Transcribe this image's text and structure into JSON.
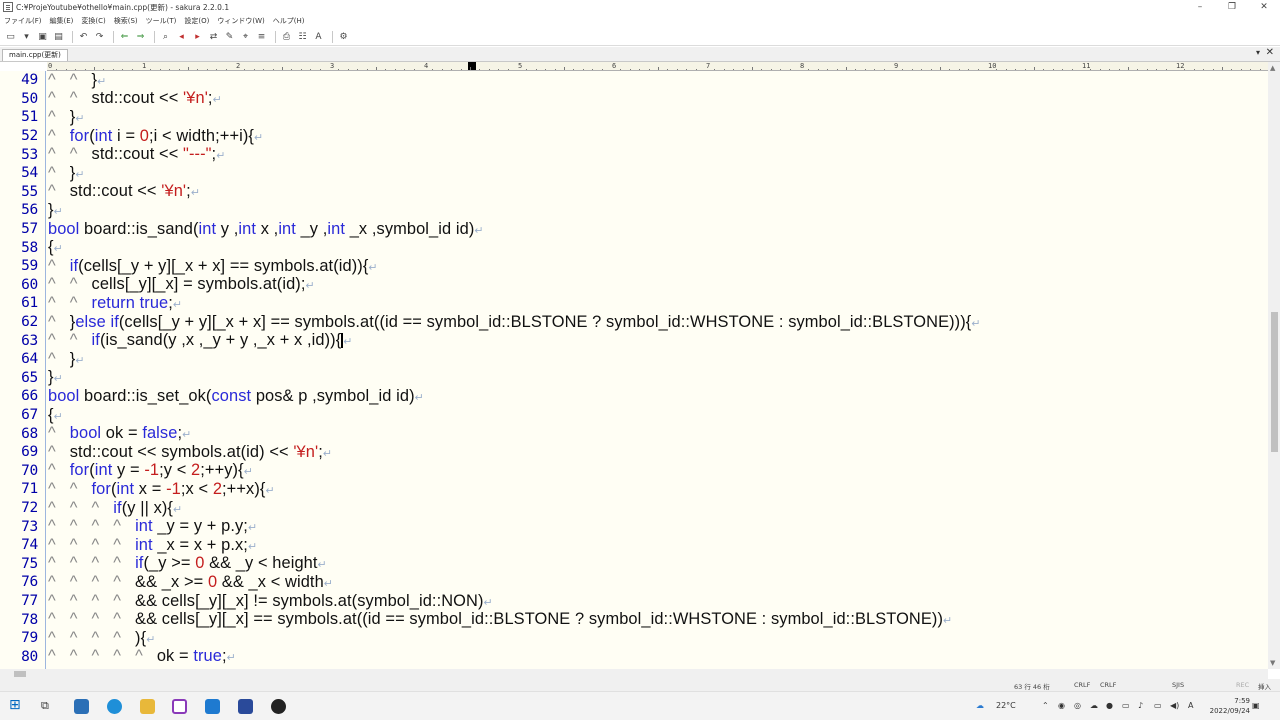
{
  "window": {
    "title": "C:¥ProjeYoutube¥othello¥main.cpp(更新) - sakura 2.2.0.1",
    "controls": {
      "minimize": "–",
      "restore": "❐",
      "close": "✕"
    }
  },
  "menu": [
    "ファイル(F)",
    "編集(E)",
    "変換(C)",
    "検索(S)",
    "ツール(T)",
    "設定(O)",
    "ウィンドウ(W)",
    "ヘルプ(H)"
  ],
  "tab": {
    "label": "main.cpp(更新)",
    "menu_glyph": "▾",
    "close_glyph": "✕"
  },
  "ruler": [
    "0",
    "1",
    "2",
    "3",
    "4",
    "5",
    "6",
    "7",
    "8",
    "9",
    "10",
    "11",
    "12"
  ],
  "lines": [
    {
      "n": "49",
      "html": "<span class=\"tabm\">^</span>   <span class=\"tabm\">^</span>   }<span class=\"crlf\">↵</span>"
    },
    {
      "n": "50",
      "html": "<span class=\"tabm\">^</span>   <span class=\"tabm\">^</span>   std::cout &lt;&lt; <span class=\"str\">'¥n'</span>;<span class=\"crlf\">↵</span>"
    },
    {
      "n": "51",
      "html": "<span class=\"tabm\">^</span>   }<span class=\"crlf\">↵</span>"
    },
    {
      "n": "52",
      "html": "<span class=\"tabm\">^</span>   <span class=\"kw\">for</span>(<span class=\"kw\">int</span> i = <span class=\"num\">0</span>;i &lt; width;++i){<span class=\"crlf\">↵</span>"
    },
    {
      "n": "53",
      "html": "<span class=\"tabm\">^</span>   <span class=\"tabm\">^</span>   std::cout &lt;&lt; <span class=\"str\">\"---\"</span>;<span class=\"crlf\">↵</span>"
    },
    {
      "n": "54",
      "html": "<span class=\"tabm\">^</span>   }<span class=\"crlf\">↵</span>"
    },
    {
      "n": "55",
      "html": "<span class=\"tabm\">^</span>   std::cout &lt;&lt; <span class=\"str\">'¥n'</span>;<span class=\"crlf\">↵</span>"
    },
    {
      "n": "56",
      "html": "}<span class=\"crlf\">↵</span>"
    },
    {
      "n": "57",
      "html": "<span class=\"kw\">bool</span> board::is_sand(<span class=\"kw\">int</span> y ,<span class=\"kw\">int</span> x ,<span class=\"kw\">int</span> _y ,<span class=\"kw\">int</span> _x ,symbol_id id)<span class=\"crlf\">↵</span>"
    },
    {
      "n": "58",
      "html": "{<span class=\"crlf\">↵</span>"
    },
    {
      "n": "59",
      "html": "<span class=\"tabm\">^</span>   <span class=\"kw\">if</span>(cells[_y + y][_x + x] == symbols.at(id)){<span class=\"crlf\">↵</span>"
    },
    {
      "n": "60",
      "html": "<span class=\"tabm\">^</span>   <span class=\"tabm\">^</span>   cells[_y][_x] = symbols.at(id);<span class=\"crlf\">↵</span>"
    },
    {
      "n": "61",
      "html": "<span class=\"tabm\">^</span>   <span class=\"tabm\">^</span>   <span class=\"kw\">return</span> <span class=\"kw\">true</span>;<span class=\"crlf\">↵</span>"
    },
    {
      "n": "62",
      "html": "<span class=\"tabm\">^</span>   }<span class=\"kw\">else</span> <span class=\"kw\">if</span>(cells[_y + y][_x + x] == symbols.at((id == symbol_id::BLSTONE ? symbol_id::WHSTONE : symbol_id::BLSTONE))){<span class=\"crlf\">↵</span>"
    },
    {
      "n": "63",
      "html": "<span class=\"tabm\">^</span>   <span class=\"tabm\">^</span>   <span class=\"kw\">if</span>(is_sand(y ,x ,_y + y ,_x + x ,id)){<span class=\"caret\"></span><span class=\"crlf\">↵</span>"
    },
    {
      "n": "64",
      "html": "<span class=\"tabm\">^</span>   }<span class=\"crlf\">↵</span>"
    },
    {
      "n": "65",
      "html": "}<span class=\"crlf\">↵</span>"
    },
    {
      "n": "66",
      "html": "<span class=\"kw\">bool</span> board::is_set_ok(<span class=\"kw\">const</span> pos&amp; p ,symbol_id id)<span class=\"crlf\">↵</span>"
    },
    {
      "n": "67",
      "html": "{<span class=\"crlf\">↵</span>"
    },
    {
      "n": "68",
      "html": "<span class=\"tabm\">^</span>   <span class=\"kw\">bool</span> ok = <span class=\"kw\">false</span>;<span class=\"crlf\">↵</span>"
    },
    {
      "n": "69",
      "html": "<span class=\"tabm\">^</span>   std::cout &lt;&lt; symbols.at(id) &lt;&lt; <span class=\"str\">'¥n'</span>;<span class=\"crlf\">↵</span>"
    },
    {
      "n": "70",
      "html": "<span class=\"tabm\">^</span>   <span class=\"kw\">for</span>(<span class=\"kw\">int</span> y = <span class=\"num\">-1</span>;y &lt; <span class=\"num\">2</span>;++y){<span class=\"crlf\">↵</span>"
    },
    {
      "n": "71",
      "html": "<span class=\"tabm\">^</span>   <span class=\"tabm\">^</span>   <span class=\"kw\">for</span>(<span class=\"kw\">int</span> x = <span class=\"num\">-1</span>;x &lt; <span class=\"num\">2</span>;++x){<span class=\"crlf\">↵</span>"
    },
    {
      "n": "72",
      "html": "<span class=\"tabm\">^</span>   <span class=\"tabm\">^</span>   <span class=\"tabm\">^</span>   <span class=\"kw\">if</span>(y || x){<span class=\"crlf\">↵</span>"
    },
    {
      "n": "73",
      "html": "<span class=\"tabm\">^</span>   <span class=\"tabm\">^</span>   <span class=\"tabm\">^</span>   <span class=\"tabm\">^</span>   <span class=\"kw\">int</span> _y = y + p.y;<span class=\"crlf\">↵</span>"
    },
    {
      "n": "74",
      "html": "<span class=\"tabm\">^</span>   <span class=\"tabm\">^</span>   <span class=\"tabm\">^</span>   <span class=\"tabm\">^</span>   <span class=\"kw\">int</span> _x = x + p.x;<span class=\"crlf\">↵</span>"
    },
    {
      "n": "75",
      "html": "<span class=\"tabm\">^</span>   <span class=\"tabm\">^</span>   <span class=\"tabm\">^</span>   <span class=\"tabm\">^</span>   <span class=\"kw\">if</span>(_y &gt;= <span class=\"num\">0</span> &amp;&amp; _y &lt; height<span class=\"crlf\">↵</span>"
    },
    {
      "n": "76",
      "html": "<span class=\"tabm\">^</span>   <span class=\"tabm\">^</span>   <span class=\"tabm\">^</span>   <span class=\"tabm\">^</span>   &amp;&amp; _x &gt;= <span class=\"num\">0</span> &amp;&amp; _x &lt; width<span class=\"crlf\">↵</span>"
    },
    {
      "n": "77",
      "html": "<span class=\"tabm\">^</span>   <span class=\"tabm\">^</span>   <span class=\"tabm\">^</span>   <span class=\"tabm\">^</span>   &amp;&amp; cells[_y][_x] != symbols.at(symbol_id::NON)<span class=\"crlf\">↵</span>"
    },
    {
      "n": "78",
      "html": "<span class=\"tabm\">^</span>   <span class=\"tabm\">^</span>   <span class=\"tabm\">^</span>   <span class=\"tabm\">^</span>   &amp;&amp; cells[_y][_x] == symbols.at((id == symbol_id::BLSTONE ? symbol_id::WHSTONE : symbol_id::BLSTONE))<span class=\"crlf\">↵</span>"
    },
    {
      "n": "79",
      "html": "<span class=\"tabm\">^</span>   <span class=\"tabm\">^</span>   <span class=\"tabm\">^</span>   <span class=\"tabm\">^</span>   ){<span class=\"crlf\">↵</span>"
    },
    {
      "n": "80",
      "html": "<span class=\"tabm\">^</span>   <span class=\"tabm\">^</span>   <span class=\"tabm\">^</span>   <span class=\"tabm\">^</span>   <span class=\"tabm\">^</span>   ok = <span class=\"kw\">true</span>;<span class=\"crlf\">↵</span>"
    }
  ],
  "status": {
    "position": "63 行  46 桁",
    "eol1": "CRLF",
    "eol2": "CRLF",
    "encoding": "SJIS",
    "rec": "REC",
    "mode": "挿入"
  },
  "taskbar": {
    "weather": "22°C",
    "time": "7:59",
    "date": "2022/09/24",
    "ime": "A"
  }
}
